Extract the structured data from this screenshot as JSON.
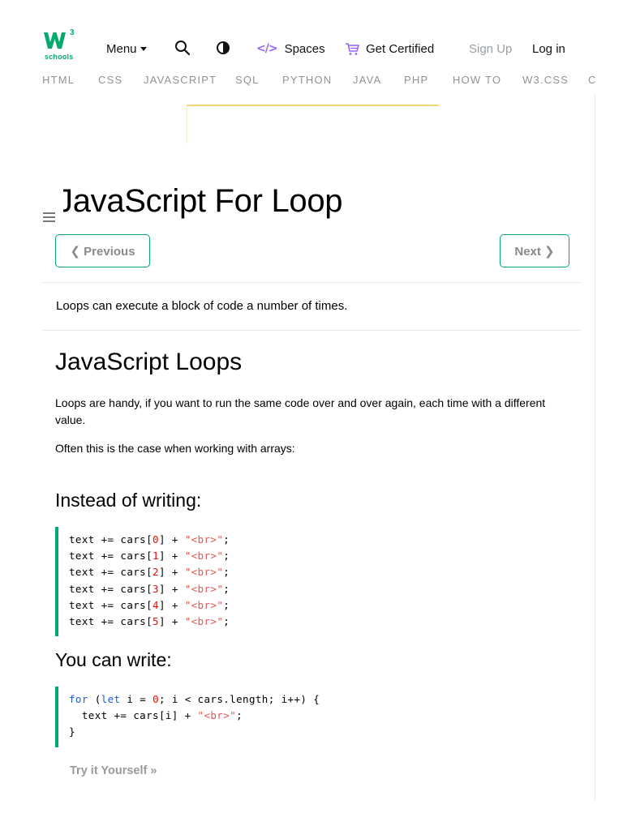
{
  "header": {
    "logo": {
      "sup": "3",
      "word": "schools",
      "accent_color": "#04aa6d"
    },
    "menu_label": "Menu",
    "spaces_label": "Spaces",
    "certified_label": "Get Certified",
    "signup_label": "Sign Up",
    "login_label": "Log in"
  },
  "subnav": {
    "items": [
      "HTML",
      "CSS",
      "JAVASCRIPT",
      "SQL",
      "PYTHON",
      "JAVA",
      "PHP",
      "HOW TO",
      "W3.CSS",
      "C"
    ]
  },
  "main": {
    "title": "JavaScript For Loop",
    "prev_label": "❮ Previous",
    "next_label": "Next ❯",
    "intro": "Loops can execute a block of code a number of times.",
    "section_heading": "JavaScript Loops",
    "para1": "Loops are handy, if you want to run the same code over and over again, each time with a different value.",
    "para2": "Often this is the case when working with arrays:",
    "heading_instead": "Instead of writing:",
    "code_instead": [
      {
        "pre": "text += cars[",
        "num": "0",
        "mid": "] + ",
        "str": "\"<br>\"",
        "end": ";"
      },
      {
        "pre": "text += cars[",
        "num": "1",
        "mid": "] + ",
        "str": "\"<br>\"",
        "end": ";"
      },
      {
        "pre": "text += cars[",
        "num": "2",
        "mid": "] + ",
        "str": "\"<br>\"",
        "end": ";"
      },
      {
        "pre": "text += cars[",
        "num": "3",
        "mid": "] + ",
        "str": "\"<br>\"",
        "end": ";"
      },
      {
        "pre": "text += cars[",
        "num": "4",
        "mid": "] + ",
        "str": "\"<br>\"",
        "end": ";"
      },
      {
        "pre": "text += cars[",
        "num": "5",
        "mid": "] + ",
        "str": "\"<br>\"",
        "end": ";"
      }
    ],
    "heading_write": "You can write:",
    "code_write": {
      "kw_for": "for",
      "paren_open": " (",
      "kw_let": "let",
      "loop_a": " i = ",
      "zero": "0",
      "loop_b": "; i < cars.length; i++) {",
      "body_pre": "  text += cars[i] + ",
      "body_str": "\"<br>\"",
      "body_end": ";",
      "close": "}"
    },
    "try_label": "Try it Yourself »"
  },
  "colors": {
    "brand_green": "#04aa6d",
    "spaces_purple": "#9763f6",
    "keyword_blue": "#1a5ccc",
    "number_red": "#ff0000",
    "string_red": "#e25555"
  }
}
